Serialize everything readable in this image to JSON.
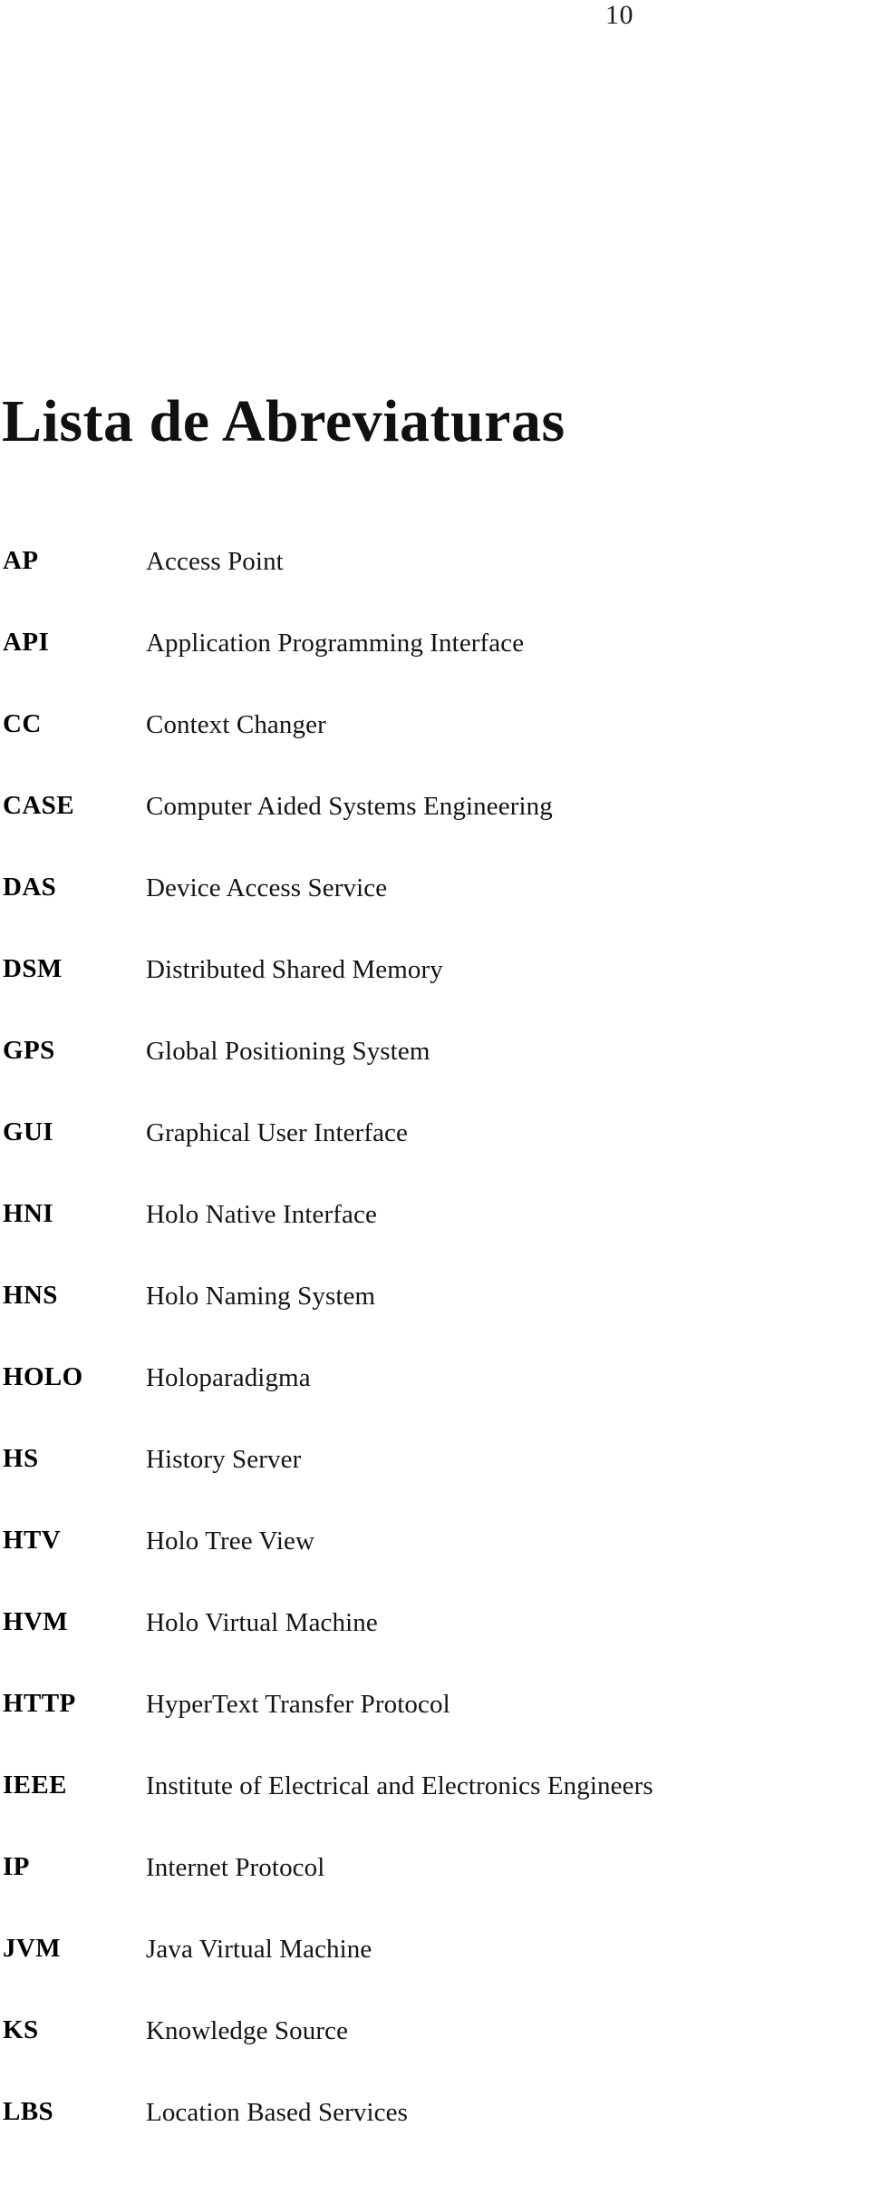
{
  "page": {
    "folio": "10",
    "title": "Lista de Abreviaturas"
  },
  "abbreviations": [
    {
      "term": "AP",
      "definition": "Access Point"
    },
    {
      "term": "API",
      "definition": "Application Programming Interface"
    },
    {
      "term": "CC",
      "definition": "Context Changer"
    },
    {
      "term": "CASE",
      "definition": "Computer Aided Systems Engineering"
    },
    {
      "term": "DAS",
      "definition": "Device Access Service"
    },
    {
      "term": "DSM",
      "definition": "Distributed Shared Memory"
    },
    {
      "term": "GPS",
      "definition": "Global Positioning System"
    },
    {
      "term": "GUI",
      "definition": "Graphical User Interface"
    },
    {
      "term": "HNI",
      "definition": "Holo Native Interface"
    },
    {
      "term": "HNS",
      "definition": "Holo Naming System"
    },
    {
      "term": "HOLO",
      "definition": "Holoparadigma"
    },
    {
      "term": "HS",
      "definition": "History Server"
    },
    {
      "term": "HTV",
      "definition": "Holo Tree View"
    },
    {
      "term": "HVM",
      "definition": "Holo Virtual Machine"
    },
    {
      "term": "HTTP",
      "definition": "HyperText Transfer Protocol"
    },
    {
      "term": "IEEE",
      "definition": "Institute of Electrical and Electronics Engineers"
    },
    {
      "term": "IP",
      "definition": "Internet Protocol"
    },
    {
      "term": "JVM",
      "definition": "Java Virtual Machine"
    },
    {
      "term": "KS",
      "definition": "Knowledge Source"
    },
    {
      "term": "LBS",
      "definition": "Location Based Services"
    }
  ]
}
